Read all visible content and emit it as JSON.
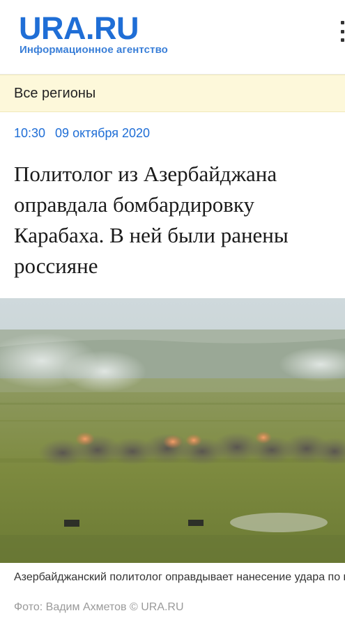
{
  "header": {
    "logo_text": "URA.RU",
    "logo_subtitle": "Информационное агентство",
    "menu_icon": "more-vertical-icon"
  },
  "region": {
    "label": "Все регионы"
  },
  "article": {
    "time": "10:30",
    "date": "09 октября 2020",
    "headline": "Политолог из Азербайджана оправдала бомбардировку Карабаха. В ней были ранены россияне",
    "photo_caption": "Азербайджанский политолог оправдывает нанесение удара по церкви в Шуши (архивное фо",
    "photo_credit": "Фото: Вадим Ахметов © URA.RU"
  },
  "colors": {
    "brand_blue": "#1f6ed6",
    "region_bar": "#fdf8da"
  }
}
